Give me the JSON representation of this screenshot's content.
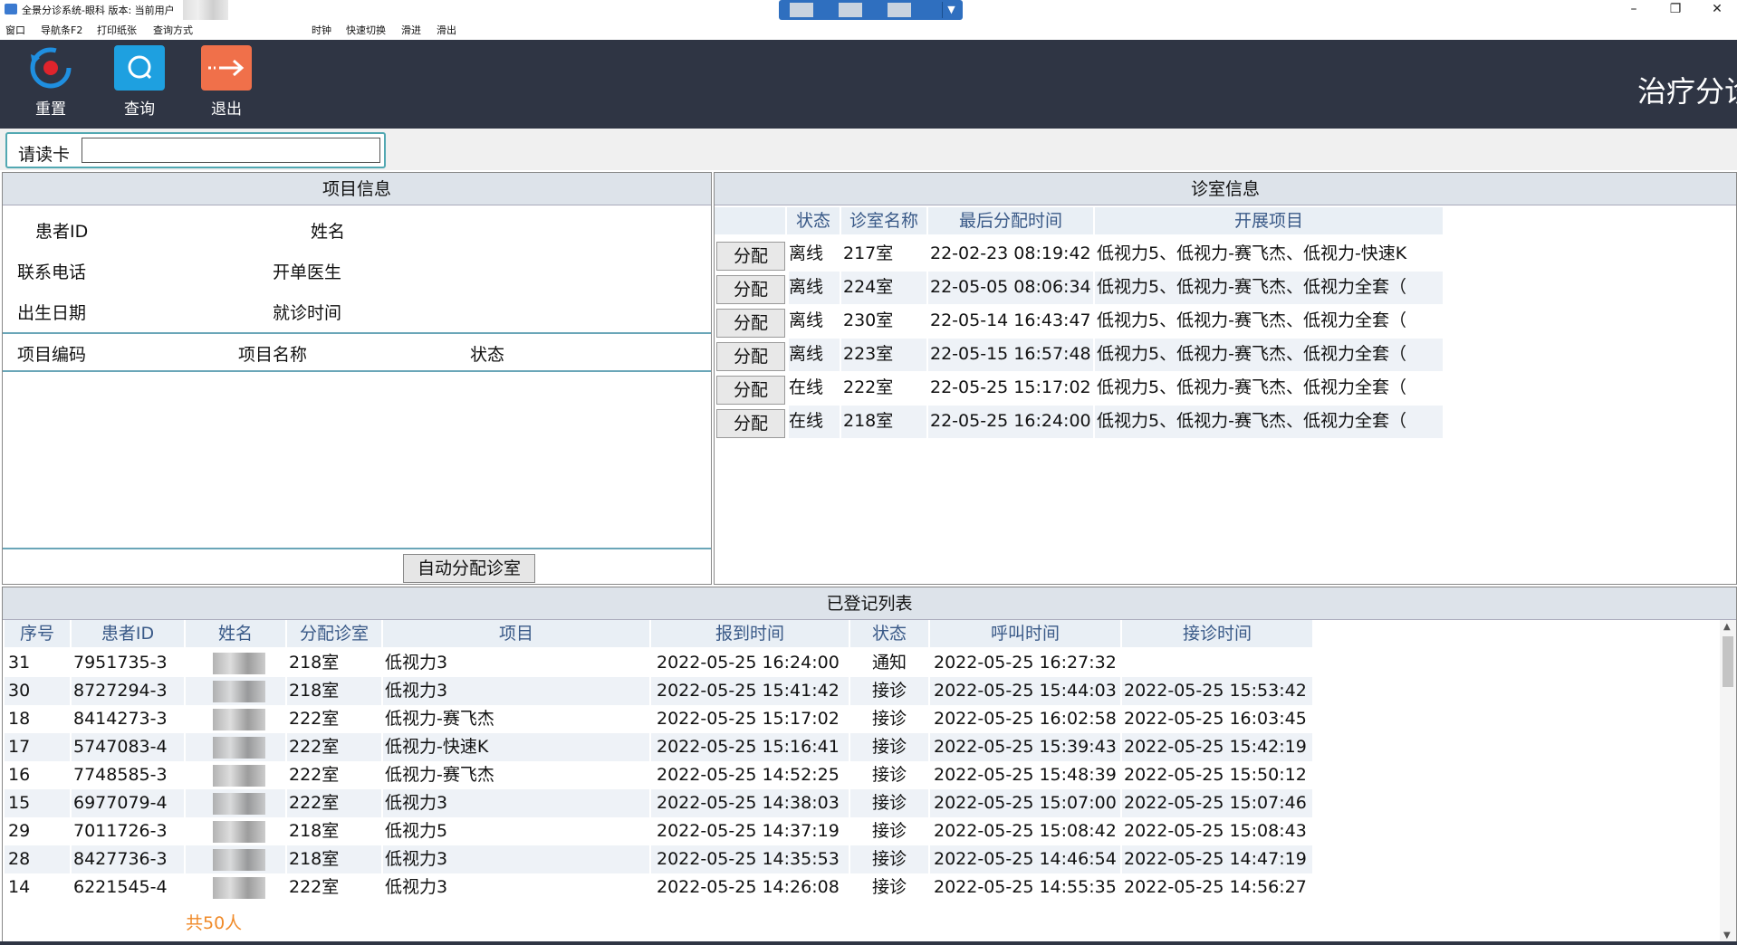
{
  "window": {
    "title": "全景分诊系统-眼科 版本: 当前用户",
    "controls": [
      "–",
      "❐",
      "✕"
    ]
  },
  "menu": [
    "窗口",
    "导航条F2",
    "打印纸张",
    "查询方式",
    "时钟",
    "快速切换",
    "滑进",
    "滑出"
  ],
  "toolbar": {
    "reset_label": "重置",
    "query_label": "查询",
    "exit_label": "退出",
    "header_title": "治疗分诊"
  },
  "card": {
    "label": "请读卡",
    "value": ""
  },
  "project_info": {
    "header": "项目信息",
    "fields": {
      "patient_id": "患者ID",
      "name": "姓名",
      "phone": "联系电话",
      "doctor": "开单医生",
      "birth": "出生日期",
      "visit_time": "就诊时间"
    },
    "columns": [
      "项目编码",
      "项目名称",
      "状态"
    ],
    "auto_assign": "自动分配诊室"
  },
  "room_info": {
    "header": "诊室信息",
    "columns": [
      "状态",
      "诊室名称",
      "最后分配时间",
      "开展项目"
    ],
    "assign_label": "分配",
    "rows": [
      {
        "status": "离线",
        "room": "217室",
        "last_time": "22-02-23 08:19:42",
        "projects": "低视力5、低视力-赛飞杰、低视力-快速K"
      },
      {
        "status": "离线",
        "room": "224室",
        "last_time": "22-05-05 08:06:34",
        "projects": "低视力5、低视力-赛飞杰、低视力全套（"
      },
      {
        "status": "离线",
        "room": "230室",
        "last_time": "22-05-14 16:43:47",
        "projects": "低视力5、低视力-赛飞杰、低视力全套（"
      },
      {
        "status": "离线",
        "room": "223室",
        "last_time": "22-05-15 16:57:48",
        "projects": "低视力5、低视力-赛飞杰、低视力全套（"
      },
      {
        "status": "在线",
        "room": "222室",
        "last_time": "22-05-25 15:17:02",
        "projects": "低视力5、低视力-赛飞杰、低视力全套（"
      },
      {
        "status": "在线",
        "room": "218室",
        "last_time": "22-05-25 16:24:00",
        "projects": "低视力5、低视力-赛飞杰、低视力全套（"
      }
    ]
  },
  "registered": {
    "header": "已登记列表",
    "columns": [
      "序号",
      "患者ID",
      "姓名",
      "分配诊室",
      "项目",
      "报到时间",
      "状态",
      "呼叫时间",
      "接诊时间"
    ],
    "rows": [
      {
        "no": "31",
        "pid": "7951735-3",
        "room": "218室",
        "item": "低视力3",
        "report": "2022-05-25 16:24:00",
        "status": "通知",
        "call": "2022-05-25 16:27:32",
        "receive": ""
      },
      {
        "no": "30",
        "pid": "8727294-3",
        "room": "218室",
        "item": "低视力3",
        "report": "2022-05-25 15:41:42",
        "status": "接诊",
        "call": "2022-05-25 15:44:03",
        "receive": "2022-05-25 15:53:42"
      },
      {
        "no": "18",
        "pid": "8414273-3",
        "room": "222室",
        "item": "低视力-赛飞杰",
        "report": "2022-05-25 15:17:02",
        "status": "接诊",
        "call": "2022-05-25 16:02:58",
        "receive": "2022-05-25 16:03:45"
      },
      {
        "no": "17",
        "pid": "5747083-4",
        "room": "222室",
        "item": "低视力-快速K",
        "report": "2022-05-25 15:16:41",
        "status": "接诊",
        "call": "2022-05-25 15:39:43",
        "receive": "2022-05-25 15:42:19"
      },
      {
        "no": "16",
        "pid": "7748585-3",
        "room": "222室",
        "item": "低视力-赛飞杰",
        "report": "2022-05-25 14:52:25",
        "status": "接诊",
        "call": "2022-05-25 15:48:39",
        "receive": "2022-05-25 15:50:12"
      },
      {
        "no": "15",
        "pid": "6977079-4",
        "room": "222室",
        "item": "低视力3",
        "report": "2022-05-25 14:38:03",
        "status": "接诊",
        "call": "2022-05-25 15:07:00",
        "receive": "2022-05-25 15:07:46"
      },
      {
        "no": "29",
        "pid": "7011726-3",
        "room": "218室",
        "item": "低视力5",
        "report": "2022-05-25 14:37:19",
        "status": "接诊",
        "call": "2022-05-25 15:08:42",
        "receive": "2022-05-25 15:08:43"
      },
      {
        "no": "28",
        "pid": "8427736-3",
        "room": "218室",
        "item": "低视力3",
        "report": "2022-05-25 14:35:53",
        "status": "接诊",
        "call": "2022-05-25 14:46:54",
        "receive": "2022-05-25 14:47:19"
      },
      {
        "no": "14",
        "pid": "6221545-4",
        "room": "222室",
        "item": "低视力3",
        "report": "2022-05-25 14:26:08",
        "status": "接诊",
        "call": "2022-05-25 14:55:35",
        "receive": "2022-05-25 14:56:27"
      }
    ],
    "total": "共50人"
  },
  "colors": {
    "toolbar_bg": "#2f3544",
    "reset_icon": "#1f8fe0",
    "query_icon": "#1ea0e0",
    "exit_icon": "#f0704a",
    "total_text": "#f08a28",
    "quick_switch": "#2f6fbf"
  },
  "icons": {
    "reset": "reset-icon",
    "query": "search-icon",
    "exit": "exit-arrow-icon"
  }
}
